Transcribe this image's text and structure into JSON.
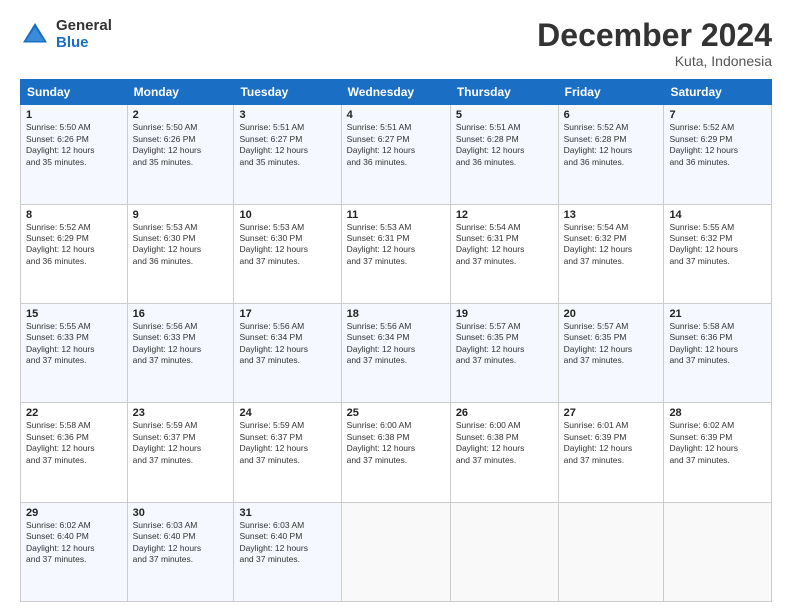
{
  "header": {
    "logo_general": "General",
    "logo_blue": "Blue",
    "month_title": "December 2024",
    "location": "Kuta, Indonesia"
  },
  "days_of_week": [
    "Sunday",
    "Monday",
    "Tuesday",
    "Wednesday",
    "Thursday",
    "Friday",
    "Saturday"
  ],
  "weeks": [
    [
      {
        "day": "1",
        "sunrise": "5:50 AM",
        "sunset": "6:26 PM",
        "daylight_h": "12",
        "daylight_m": "35"
      },
      {
        "day": "2",
        "sunrise": "5:50 AM",
        "sunset": "6:26 PM",
        "daylight_h": "12",
        "daylight_m": "35"
      },
      {
        "day": "3",
        "sunrise": "5:51 AM",
        "sunset": "6:27 PM",
        "daylight_h": "12",
        "daylight_m": "35"
      },
      {
        "day": "4",
        "sunrise": "5:51 AM",
        "sunset": "6:27 PM",
        "daylight_h": "12",
        "daylight_m": "36"
      },
      {
        "day": "5",
        "sunrise": "5:51 AM",
        "sunset": "6:28 PM",
        "daylight_h": "12",
        "daylight_m": "36"
      },
      {
        "day": "6",
        "sunrise": "5:52 AM",
        "sunset": "6:28 PM",
        "daylight_h": "12",
        "daylight_m": "36"
      },
      {
        "day": "7",
        "sunrise": "5:52 AM",
        "sunset": "6:29 PM",
        "daylight_h": "12",
        "daylight_m": "36"
      }
    ],
    [
      {
        "day": "8",
        "sunrise": "5:52 AM",
        "sunset": "6:29 PM",
        "daylight_h": "12",
        "daylight_m": "36"
      },
      {
        "day": "9",
        "sunrise": "5:53 AM",
        "sunset": "6:30 PM",
        "daylight_h": "12",
        "daylight_m": "36"
      },
      {
        "day": "10",
        "sunrise": "5:53 AM",
        "sunset": "6:30 PM",
        "daylight_h": "12",
        "daylight_m": "37"
      },
      {
        "day": "11",
        "sunrise": "5:53 AM",
        "sunset": "6:31 PM",
        "daylight_h": "12",
        "daylight_m": "37"
      },
      {
        "day": "12",
        "sunrise": "5:54 AM",
        "sunset": "6:31 PM",
        "daylight_h": "12",
        "daylight_m": "37"
      },
      {
        "day": "13",
        "sunrise": "5:54 AM",
        "sunset": "6:32 PM",
        "daylight_h": "12",
        "daylight_m": "37"
      },
      {
        "day": "14",
        "sunrise": "5:55 AM",
        "sunset": "6:32 PM",
        "daylight_h": "12",
        "daylight_m": "37"
      }
    ],
    [
      {
        "day": "15",
        "sunrise": "5:55 AM",
        "sunset": "6:33 PM",
        "daylight_h": "12",
        "daylight_m": "37"
      },
      {
        "day": "16",
        "sunrise": "5:56 AM",
        "sunset": "6:33 PM",
        "daylight_h": "12",
        "daylight_m": "37"
      },
      {
        "day": "17",
        "sunrise": "5:56 AM",
        "sunset": "6:34 PM",
        "daylight_h": "12",
        "daylight_m": "37"
      },
      {
        "day": "18",
        "sunrise": "5:56 AM",
        "sunset": "6:34 PM",
        "daylight_h": "12",
        "daylight_m": "37"
      },
      {
        "day": "19",
        "sunrise": "5:57 AM",
        "sunset": "6:35 PM",
        "daylight_h": "12",
        "daylight_m": "37"
      },
      {
        "day": "20",
        "sunrise": "5:57 AM",
        "sunset": "6:35 PM",
        "daylight_h": "12",
        "daylight_m": "37"
      },
      {
        "day": "21",
        "sunrise": "5:58 AM",
        "sunset": "6:36 PM",
        "daylight_h": "12",
        "daylight_m": "37"
      }
    ],
    [
      {
        "day": "22",
        "sunrise": "5:58 AM",
        "sunset": "6:36 PM",
        "daylight_h": "12",
        "daylight_m": "37"
      },
      {
        "day": "23",
        "sunrise": "5:59 AM",
        "sunset": "6:37 PM",
        "daylight_h": "12",
        "daylight_m": "37"
      },
      {
        "day": "24",
        "sunrise": "5:59 AM",
        "sunset": "6:37 PM",
        "daylight_h": "12",
        "daylight_m": "37"
      },
      {
        "day": "25",
        "sunrise": "6:00 AM",
        "sunset": "6:38 PM",
        "daylight_h": "12",
        "daylight_m": "37"
      },
      {
        "day": "26",
        "sunrise": "6:00 AM",
        "sunset": "6:38 PM",
        "daylight_h": "12",
        "daylight_m": "37"
      },
      {
        "day": "27",
        "sunrise": "6:01 AM",
        "sunset": "6:39 PM",
        "daylight_h": "12",
        "daylight_m": "37"
      },
      {
        "day": "28",
        "sunrise": "6:02 AM",
        "sunset": "6:39 PM",
        "daylight_h": "12",
        "daylight_m": "37"
      }
    ],
    [
      {
        "day": "29",
        "sunrise": "6:02 AM",
        "sunset": "6:40 PM",
        "daylight_h": "12",
        "daylight_m": "37"
      },
      {
        "day": "30",
        "sunrise": "6:03 AM",
        "sunset": "6:40 PM",
        "daylight_h": "12",
        "daylight_m": "37"
      },
      {
        "day": "31",
        "sunrise": "6:03 AM",
        "sunset": "6:40 PM",
        "daylight_h": "12",
        "daylight_m": "37"
      },
      null,
      null,
      null,
      null
    ]
  ],
  "labels": {
    "sunrise": "Sunrise:",
    "sunset": "Sunset:",
    "daylight": "Daylight: ",
    "hours": " hours",
    "and": "and ",
    "minutes": " minutes."
  }
}
